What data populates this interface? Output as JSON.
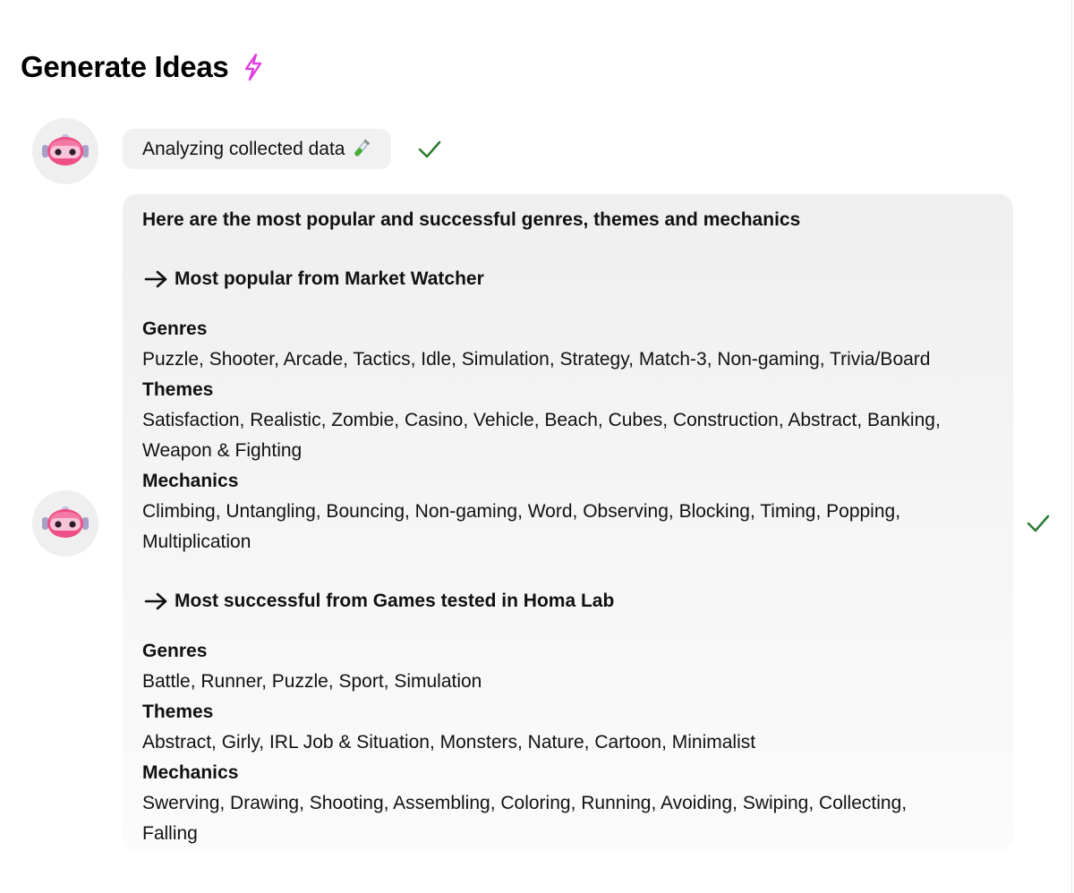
{
  "page": {
    "title": "Generate Ideas",
    "title_icon": "lightning-bolt-icon",
    "accent_color": "#e23fe0"
  },
  "status": {
    "label": "Analyzing collected data",
    "icon": "test-tube-icon",
    "done_icon": "checkmark-icon",
    "check_color": "#2e7d32"
  },
  "result": {
    "intro": "Here are the most popular and successful genres, themes and mechanics",
    "sections": [
      {
        "heading": "Most popular from Market Watcher",
        "genres_label": "Genres",
        "genres": "Puzzle, Shooter, Arcade, Tactics, Idle, Simulation, Strategy, Match-3, Non-gaming, Trivia/Board",
        "themes_label": "Themes",
        "themes_1": "Satisfaction, Realistic, Zombie, Casino, Vehicle, Beach, Cubes, Construction, Abstract, Banking,",
        "themes_2": "Weapon & Fighting",
        "mechanics_label": "Mechanics",
        "mechanics_1": "Climbing, Untangling, Bouncing, Non-gaming, Word, Observing, Blocking, Timing, Popping,",
        "mechanics_2": "Multiplication"
      },
      {
        "heading": "Most successful from Games tested in Homa Lab",
        "genres_label": "Genres",
        "genres": "Battle, Runner, Puzzle, Sport, Simulation",
        "themes_label": "Themes",
        "themes_1": "Abstract, Girly, IRL Job & Situation, Monsters, Nature, Cartoon, Minimalist",
        "mechanics_label": "Mechanics",
        "mechanics_1": "Swerving, Drawing, Shooting, Assembling, Coloring, Running, Avoiding, Swiping, Collecting,",
        "mechanics_2": "Falling"
      }
    ]
  },
  "avatar": {
    "icon": "robot-avatar-icon",
    "color": "#ee4f86"
  }
}
